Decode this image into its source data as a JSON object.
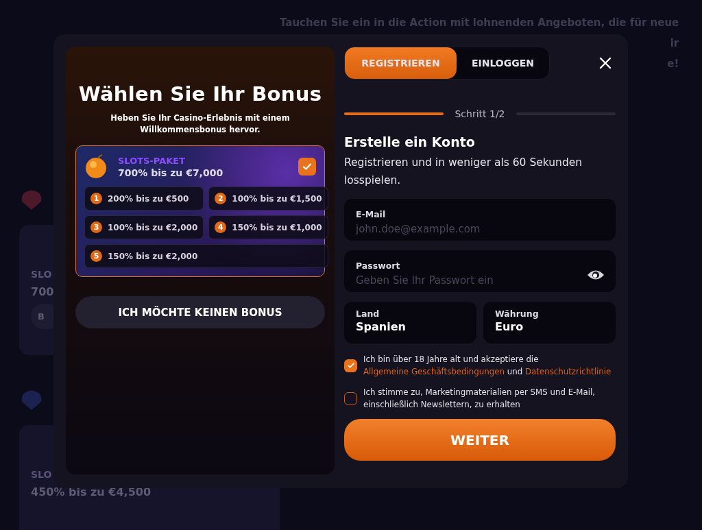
{
  "background": {
    "intro_lines": [
      "Tauchen Sie ein in die Action mit lohnenden Angeboten, die für neue",
      "ir",
      "e!"
    ],
    "sections": [
      {
        "cards": [
          {
            "title": "SLO",
            "amount": "700",
            "button": "B"
          }
        ]
      },
      {
        "cards": [
          {
            "title": "SLO",
            "amount": "450% bis zu €4,500"
          }
        ]
      }
    ]
  },
  "modal": {
    "bonus_panel": {
      "title": "Wählen Sie Ihr Bonus",
      "subtitle": "Heben Sie Ihr Casino-Erlebnis mit einem Willkommensbonus hervor.",
      "package": {
        "name": "SLOTS-PAKET",
        "amount": "700% bis zu €7,000",
        "selected": true,
        "tiers": [
          {
            "number": "1",
            "text": "200% bis zu €500"
          },
          {
            "number": "2",
            "text": "100% bis zu €1,500"
          },
          {
            "number": "3",
            "text": "100% bis zu €2,000"
          },
          {
            "number": "4",
            "text": "150% bis zu €1,000"
          },
          {
            "number": "5",
            "text": "150% bis zu €2,000"
          }
        ]
      },
      "no_bonus_button": "ICH MÖCHTE KEINEN BONUS"
    },
    "tabs": [
      {
        "label": "REGISTRIEREN",
        "selected": true
      },
      {
        "label": "EINLOGGEN",
        "selected": false
      }
    ],
    "steps": [
      {
        "done": true
      },
      {
        "done": false
      }
    ],
    "step_label": "Schritt 1/2",
    "heading": "Erstelle ein Konto",
    "intro": "Registrieren und in weniger als 60 Sekunden losspielen.",
    "fields": [
      {
        "kind": "input",
        "label": "E-Mail",
        "placeholder": "john.doe@example.com"
      },
      {
        "kind": "password",
        "label": "Passwort",
        "placeholder": "Geben Sie Ihr Passwort ein"
      }
    ],
    "selects": [
      {
        "label": "Land",
        "value": "Spanien"
      },
      {
        "label": "Währung",
        "value": "Euro"
      }
    ],
    "consents": [
      {
        "checked": true,
        "parts": [
          {
            "kind": "text",
            "text": "Ich bin über 18 Jahre alt und akzeptiere die "
          },
          {
            "kind": "link",
            "text": "Allgemeine Geschäftsbedingungen"
          },
          {
            "kind": "text",
            "text": " und "
          },
          {
            "kind": "link",
            "text": "Datenschutzrichtlinie"
          }
        ]
      },
      {
        "checked": false,
        "parts": [
          {
            "kind": "text",
            "text": "Ich stimme zu, Marketingmaterialien per SMS und E-Mail, einschließlich Newslettern, zu erhalten"
          }
        ]
      }
    ],
    "submit": "WEITER"
  }
}
